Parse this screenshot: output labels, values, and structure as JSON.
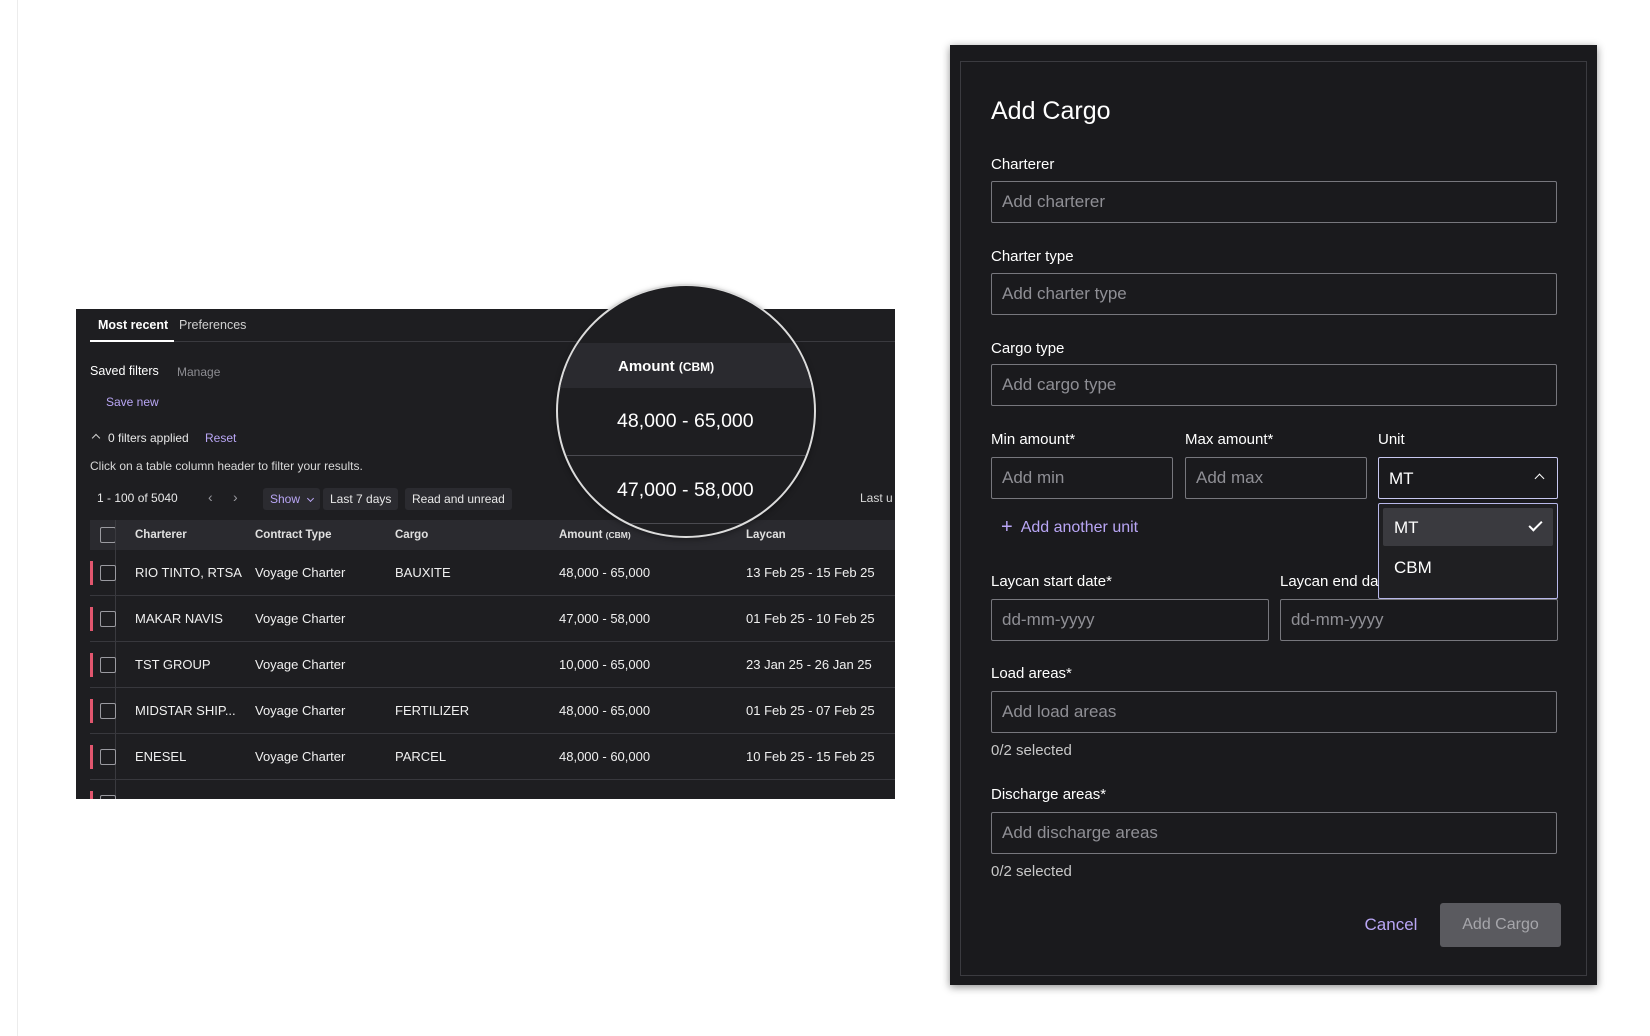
{
  "colors": {
    "accent": "#b9a6f5",
    "row_flag": "#e2566e",
    "modal_bg": "#1a1a1d",
    "table_bg": "#1e1e21"
  },
  "table": {
    "tabs": [
      "Most recent",
      "Preferences"
    ],
    "saved_filters": "Saved filters",
    "manage": "Manage",
    "save_new": "Save new",
    "filters_applied": "0 filters applied",
    "reset": "Reset",
    "hint": "Click on a table column header to filter your results.",
    "pagination": "1 - 100 of 5040",
    "show": "Show",
    "last7": "Last 7 days",
    "read_unread": "Read and unread",
    "last_updated_partial": "Last u",
    "columns": [
      "Charterer",
      "Contract Type",
      "Cargo",
      "Amount",
      "(CBM)",
      "Laycan"
    ],
    "rows": [
      {
        "charterer": "RIO TINTO, RTSA",
        "contract": "Voyage Charter",
        "cargo": "BAUXITE",
        "amount": "48,000 - 65,000",
        "laycan": "13 Feb 25 - 15 Feb 25"
      },
      {
        "charterer": "MAKAR NAVIS",
        "contract": "Voyage Charter",
        "cargo": "",
        "amount": "47,000 - 58,000",
        "laycan": "01 Feb 25 - 10 Feb 25"
      },
      {
        "charterer": "TST GROUP",
        "contract": "Voyage Charter",
        "cargo": "",
        "amount": "10,000 - 65,000",
        "laycan": "23 Jan 25 - 26 Jan 25"
      },
      {
        "charterer": "MIDSTAR SHIP...",
        "contract": "Voyage Charter",
        "cargo": "FERTILIZER",
        "amount": "48,000 - 65,000",
        "laycan": "01 Feb 25 - 07 Feb 25"
      },
      {
        "charterer": "ENESEL",
        "contract": "Voyage Charter",
        "cargo": "PARCEL",
        "amount": "48,000 - 60,000",
        "laycan": "10 Feb 25 - 15 Feb 25"
      }
    ]
  },
  "magnifier": {
    "header": "Amount",
    "unit": "(CBM)",
    "values": [
      "48,000 - 65,000",
      "47,000 - 58,000"
    ]
  },
  "modal": {
    "title": "Add Cargo",
    "charterer_label": "Charterer",
    "charterer_placeholder": "Add charterer",
    "charter_type_label": "Charter type",
    "charter_type_placeholder": "Add charter type",
    "cargo_type_label": "Cargo type",
    "cargo_type_placeholder": "Add cargo type",
    "min_label": "Min amount*",
    "min_placeholder": "Add min",
    "max_label": "Max amount*",
    "max_placeholder": "Add max",
    "unit_label": "Unit",
    "unit_value": "MT",
    "unit_options": [
      "MT",
      "CBM"
    ],
    "add_unit": "Add another unit",
    "laycan_start_label": "Laycan start date*",
    "laycan_end_label": "Laycan end da",
    "date_placeholder": "dd-mm-yyyy",
    "load_label": "Load areas*",
    "load_placeholder": "Add load areas",
    "load_helper": "0/2 selected",
    "discharge_label": "Discharge areas*",
    "discharge_placeholder": "Add discharge areas",
    "discharge_helper": "0/2 selected",
    "cancel": "Cancel",
    "submit": "Add Cargo"
  }
}
